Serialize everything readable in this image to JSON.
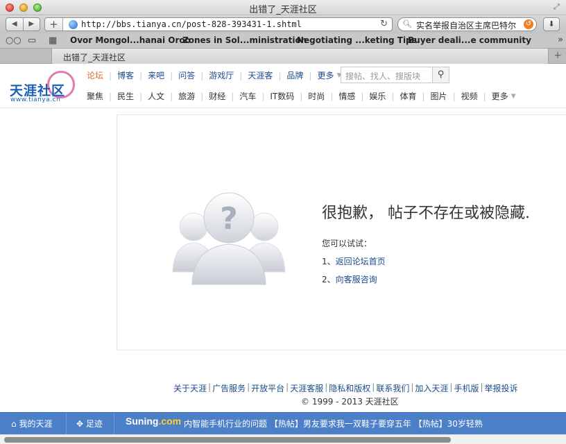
{
  "window": {
    "title": "出错了_天涯社区"
  },
  "toolbar": {
    "url": "http://bbs.tianya.cn/post-828-393431-1.shtml",
    "search_value": "实名举报自治区主席巴特尔"
  },
  "bookmarks": [
    "Ovor Mongol...hanai Oroo",
    "Zones in Sol...ministration",
    "Negotiating ...keting Tips",
    "Buyer deali...e community"
  ],
  "tab": {
    "label": "出错了_天涯社区"
  },
  "site": {
    "logo_text": "天涯社区",
    "logo_sub": "www.tianya.cn",
    "nav_primary": [
      "论坛",
      "博客",
      "来吧",
      "问答",
      "游戏厅",
      "天涯客",
      "品牌",
      "更多"
    ],
    "nav_secondary": [
      "聚焦",
      "民生",
      "人文",
      "旅游",
      "财经",
      "汽车",
      "IT数码",
      "时尚",
      "情感",
      "娱乐",
      "体育",
      "图片",
      "视频",
      "更多"
    ],
    "search_placeholder": "搜帖、找人、搜版块"
  },
  "error": {
    "title": "很抱歉， 帖子不存在或被隐藏.",
    "try_label": "您可以试试：",
    "options": [
      {
        "num": "1、",
        "link": "返回论坛首页"
      },
      {
        "num": "2、",
        "link": "向客服咨询"
      }
    ]
  },
  "footer": {
    "links": [
      "关于天涯",
      "广告服务",
      "开放平台",
      "天涯客服",
      "隐私和版权",
      "联系我们",
      "加入天涯",
      "手机版",
      "举报投诉"
    ],
    "copyright": "© 1999 - 2013 天涯社区"
  },
  "bottom_bar": {
    "my_tianya": "我的天涯",
    "footprints": "足迹",
    "suning_a": "Suning",
    "suning_b": ".com",
    "ticker": "内智能手机行业的问题 【热帖】男友要求我一双鞋子要穿五年 【热帖】30岁轻熟"
  },
  "colors": {
    "link": "#1c4a8c",
    "active_nav": "#e0672b",
    "bottom_bar": "#4b7fc7"
  }
}
